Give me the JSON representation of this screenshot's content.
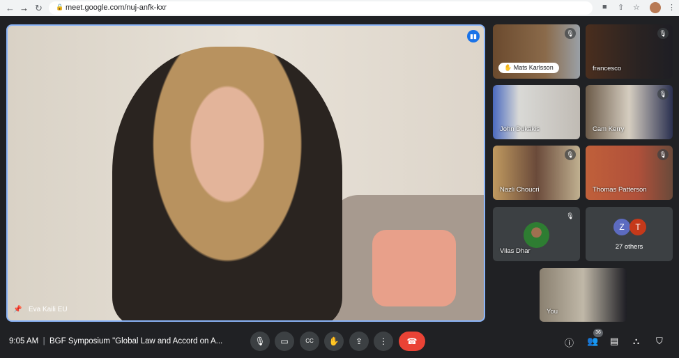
{
  "browser": {
    "url": "meet.google.com/nuj-anfk-kxr",
    "icons": [
      "back-icon",
      "forward-icon",
      "reload-icon",
      "lock-icon",
      "camera-icon",
      "share-icon",
      "star-icon",
      "profile-avatar",
      "menu-icon"
    ]
  },
  "main_video": {
    "name": "Eva Kaili EU",
    "speaking": true
  },
  "tiles": [
    {
      "name": "Mats Karlsson",
      "muted": true,
      "hand_raised": true
    },
    {
      "name": "francesco",
      "muted": true
    },
    {
      "name": "John Dukakis",
      "muted": false
    },
    {
      "name": "Cam Kerry",
      "muted": true
    },
    {
      "name": "Nazli Choucri",
      "muted": true
    },
    {
      "name": "Thomas Patterson",
      "muted": true
    },
    {
      "name": "Vilas Dhar",
      "muted": true
    }
  ],
  "others": {
    "label": "27 others",
    "initials": [
      "Z",
      "T"
    ],
    "colors": [
      "#5c6bc0",
      "#c5391a"
    ]
  },
  "self": {
    "name": "You"
  },
  "bottom": {
    "time": "9:05 AM",
    "separator": "|",
    "meeting_title": "BGF Symposium \"Global Law and Accord on A...",
    "participant_count": "36"
  },
  "colors": {
    "accent": "#8ab4f8",
    "end_call": "#ea4335",
    "background": "#202124"
  }
}
